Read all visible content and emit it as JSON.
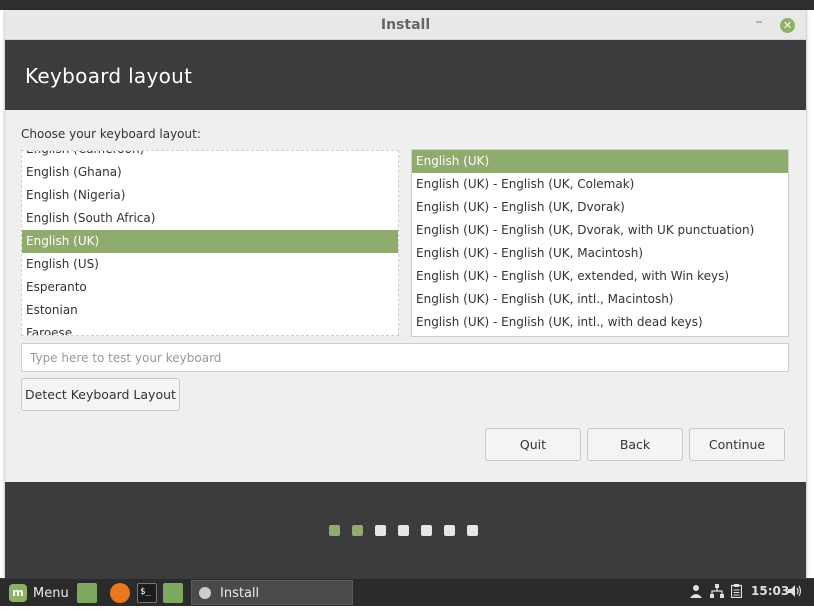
{
  "window": {
    "title": "Install",
    "minimize_glyph": "–",
    "close_glyph": "✕"
  },
  "header": {
    "title": "Keyboard layout"
  },
  "main": {
    "prompt": "Choose your keyboard layout:",
    "layouts": [
      "English (Cameroon)",
      "English (Ghana)",
      "English (Nigeria)",
      "English (South Africa)",
      "English (UK)",
      "English (US)",
      "Esperanto",
      "Estonian",
      "Faroese"
    ],
    "selected_layout": "English (UK)",
    "variants": [
      "English (UK)",
      "English (UK) - English (UK, Colemak)",
      "English (UK) - English (UK, Dvorak)",
      "English (UK) - English (UK, Dvorak, with UK punctuation)",
      "English (UK) - English (UK, Macintosh)",
      "English (UK) - English (UK, extended, with Win keys)",
      "English (UK) - English (UK, intl., Macintosh)",
      "English (UK) - English (UK, intl., with dead keys)"
    ],
    "selected_variant": "English (UK)",
    "test_input": {
      "value": "",
      "placeholder": "Type here to test your keyboard"
    },
    "detect_button": "Detect Keyboard Layout"
  },
  "actions": {
    "quit": "Quit",
    "back": "Back",
    "continue": "Continue"
  },
  "progress": {
    "total_steps": 7,
    "completed_steps": 2
  },
  "taskbar": {
    "menu_label": "Menu",
    "task_label": "Install",
    "terminal_glyph": "$_",
    "clock": "15:03",
    "icons": [
      "mint-menu-icon",
      "show-desktop-icon",
      "firefox-icon",
      "terminal-icon",
      "files-icon",
      "user-icon",
      "network-icon",
      "clipboard-icon",
      "volume-icon"
    ]
  },
  "colors": {
    "accent": "#8fab6e",
    "header_bg": "#3c3c3c",
    "window_bg": "#efefef",
    "taskbar_bg": "#2b2b2b"
  }
}
